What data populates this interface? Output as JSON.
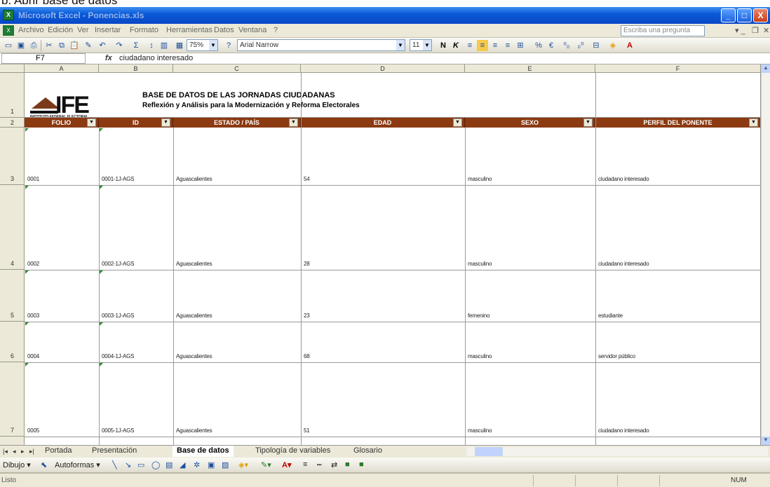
{
  "caption": "b. Abrir base de datos",
  "window": {
    "title": "Microsoft Excel - Ponencias.xls",
    "minimize": "_",
    "maximize": "□",
    "close": "X"
  },
  "menu": {
    "items": [
      "Archivo",
      "Edición",
      "Ver",
      "Insertar",
      "Formato",
      "Herramientas",
      "Datos",
      "Ventana",
      "?"
    ],
    "ask_placeholder": "Escriba una pregunta"
  },
  "toolbar": {
    "zoom": "75%",
    "font": "Arial Narrow",
    "size": "11",
    "bold": "N",
    "italic": "K"
  },
  "formula_bar": {
    "cell_ref": "F7",
    "fx": "fx",
    "content": "ciudadano interesado"
  },
  "columns": [
    "A",
    "B",
    "C",
    "D",
    "E",
    "F"
  ],
  "sheet": {
    "title": "BASE DE DATOS DE LAS JORNADAS CIUDADANAS",
    "subtitle": "Reflexión y Análisis para la Modernización y Reforma Electorales",
    "logo_text": "IFE",
    "logo_sub": "INSTITUTO FEDERAL ELECTORAL",
    "logo_sub2": "CENTRO PARA EL DESARROLLO DEMOCRATICO",
    "headers": [
      "FOLIO",
      "ID",
      "ESTADO / PAÍS",
      "EDAD",
      "SEXO",
      "PERFIL DEL PONENTE"
    ],
    "rows": [
      {
        "row_label": "3",
        "cells": [
          "0001",
          "0001-1J-AGS",
          "Aguascalientes",
          "54",
          "masculino",
          "ciudadano interesado"
        ]
      },
      {
        "row_label": "4",
        "cells": [
          "0002",
          "0002-1J-AGS",
          "Aguascalientes",
          "28",
          "masculino",
          "ciudadano interesado"
        ]
      },
      {
        "row_label": "5",
        "cells": [
          "0003",
          "0003-1J-AGS",
          "Aguascalientes",
          "23",
          "femenino",
          "estudiante"
        ]
      },
      {
        "row_label": "6",
        "cells": [
          "0004",
          "0004-1J-AGS",
          "Aguascalientes",
          "68",
          "masculino",
          "servidor público"
        ]
      },
      {
        "row_label": "7",
        "cells": [
          "0005",
          "0005-1J-AGS",
          "Aguascalientes",
          "51",
          "masculino",
          "ciudadano interesado"
        ]
      }
    ],
    "row_labels_top": [
      "1",
      "2"
    ]
  },
  "tabs": [
    "Portada",
    "Presentación",
    "Base de datos",
    "Tipología de variables",
    "Glosario"
  ],
  "active_tab": "Base de datos",
  "drawbar": {
    "draw": "Dibujo",
    "autoshapes": "Autoformas"
  },
  "status": {
    "text": "Listo",
    "num": "NUM"
  }
}
